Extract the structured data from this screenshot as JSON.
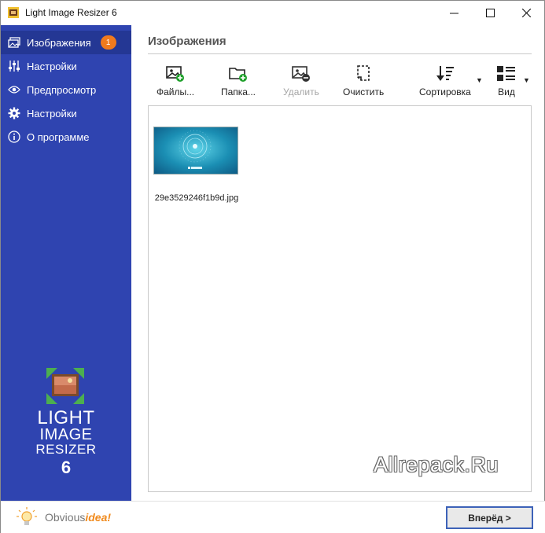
{
  "window": {
    "title": "Light Image Resizer 6",
    "controls": {
      "minimize": "—",
      "maximize": "☐",
      "close": "✕"
    }
  },
  "sidebar": {
    "items": [
      {
        "label": "Изображения",
        "icon": "images-icon",
        "active": true,
        "badge": "1"
      },
      {
        "label": "Настройки",
        "icon": "sliders-icon"
      },
      {
        "label": "Предпросмотр",
        "icon": "eye-icon"
      },
      {
        "label": "Настройки",
        "icon": "gear-icon"
      },
      {
        "label": "О программе",
        "icon": "info-icon"
      }
    ],
    "logo": {
      "line1": "LIGHT",
      "line2": "IMAGE",
      "line3": "RESIZER",
      "line4": "6"
    },
    "brand": {
      "prefix": "Obvious",
      "accent": "idea!"
    }
  },
  "main": {
    "title": "Изображения",
    "toolbar": {
      "files": "Файлы...",
      "folder": "Папка...",
      "delete": "Удалить",
      "clear": "Очистить",
      "sort": "Сортировка",
      "view": "Вид"
    },
    "images": [
      {
        "filename": "29e3529246f1b9d.jpg"
      }
    ],
    "watermark": "Allrepack.Ru"
  },
  "footer": {
    "next_button": "Вперёд >"
  },
  "colors": {
    "sidebar": "#2f44b0",
    "sidebar_active": "#243794",
    "badge": "#f07a1d",
    "accent_plus": "#1fa02b",
    "next_border": "#3d62b8"
  }
}
